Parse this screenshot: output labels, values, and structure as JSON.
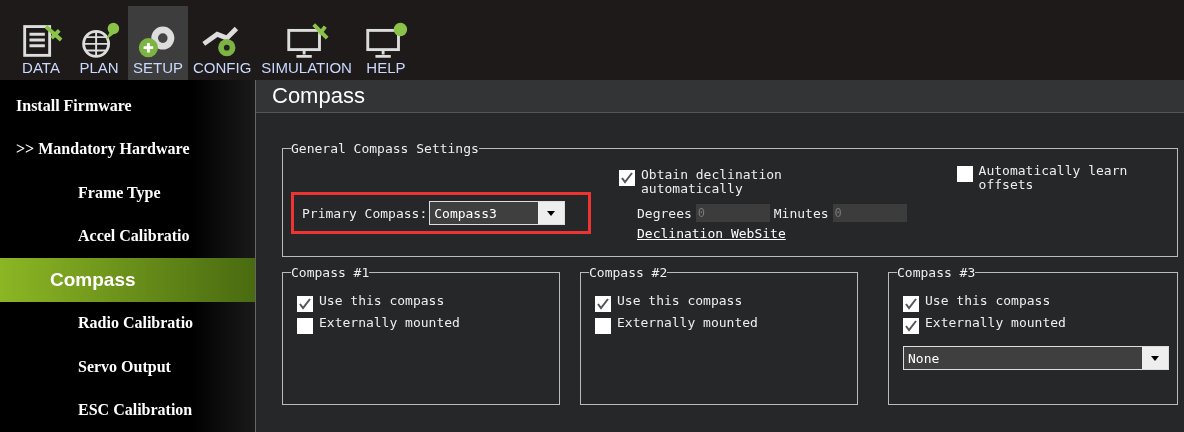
{
  "toolbar": [
    {
      "label": "DATA",
      "selected": false
    },
    {
      "label": "PLAN",
      "selected": false
    },
    {
      "label": "SETUP",
      "selected": true
    },
    {
      "label": "CONFIG",
      "selected": false
    },
    {
      "label": "SIMULATION",
      "selected": false
    },
    {
      "label": "HELP",
      "selected": false
    }
  ],
  "sidebar": {
    "items": [
      {
        "label": "Install Firmware",
        "selected": false,
        "kind": "top"
      },
      {
        "label": ">> Mandatory Hardware",
        "selected": false,
        "kind": "top"
      },
      {
        "label": "Frame Type",
        "selected": false,
        "kind": "sub"
      },
      {
        "label": "Accel Calibratio",
        "selected": false,
        "kind": "sub"
      },
      {
        "label": "Compass",
        "selected": true,
        "kind": "sub"
      },
      {
        "label": "Radio Calibratio",
        "selected": false,
        "kind": "sub"
      },
      {
        "label": "Servo Output",
        "selected": false,
        "kind": "sub"
      },
      {
        "label": "ESC Calibration",
        "selected": false,
        "kind": "sub"
      }
    ]
  },
  "page_title": "Compass",
  "general": {
    "title": "General Compass Settings",
    "primary_label": "Primary Compass:",
    "primary_value": "Compass3",
    "obtain": {
      "label": "Obtain declination automatically",
      "checked": true
    },
    "degrees_label": "Degrees",
    "degrees_value": "0",
    "minutes_label": "Minutes",
    "minutes_value": "0",
    "link": "Declination WebSite",
    "learn": {
      "label": "Automatically learn offsets",
      "checked": false
    }
  },
  "compasses": [
    {
      "title": "Compass #1",
      "use": {
        "label": "Use this compass",
        "checked": true
      },
      "external": {
        "label": "Externally mounted",
        "checked": false
      }
    },
    {
      "title": "Compass #2",
      "use": {
        "label": "Use this compass",
        "checked": true
      },
      "external": {
        "label": "Externally mounted",
        "checked": false
      }
    },
    {
      "title": "Compass #3",
      "use": {
        "label": "Use this compass",
        "checked": true
      },
      "external": {
        "label": "Externally mounted",
        "checked": true
      },
      "orientation": "None"
    }
  ]
}
